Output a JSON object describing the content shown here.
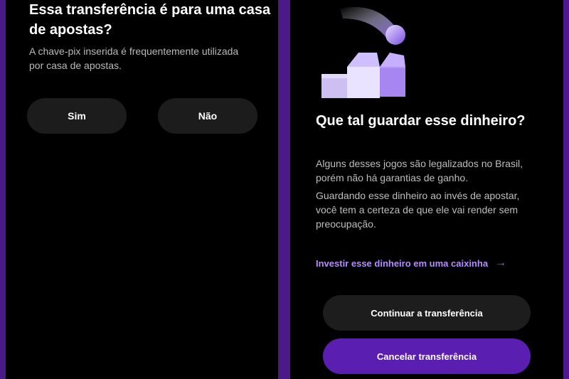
{
  "left_screen": {
    "title": "Essa transferência é para uma casa de apostas?",
    "description": "A chave-pix inserida é frequentemente utilizada por casa de apostas.",
    "yes_label": "Sim",
    "no_label": "Não"
  },
  "right_screen": {
    "illustration_icon": "boxes-illustration-icon",
    "title": "Que tal guardar esse dinheiro?",
    "paragraph1": "Alguns desses jogos são legalizados no Brasil, porém não há garantias de ganho.",
    "paragraph2": "Guardando esse dinheiro ao invés de apostar, você tem a certeza de que ele vai render sem preocupação.",
    "invest_link": "Investir esse dinheiro em uma caixinha",
    "invest_arrow": "→",
    "continue_label": "Continuar a transferência",
    "cancel_label": "Cancelar transferência"
  },
  "colors": {
    "frame": "#4a1a8a",
    "background": "#000000",
    "pill_dark": "#1c1c1c",
    "accent_purple": "#5a1fb0",
    "link_purple": "#b58cff"
  }
}
